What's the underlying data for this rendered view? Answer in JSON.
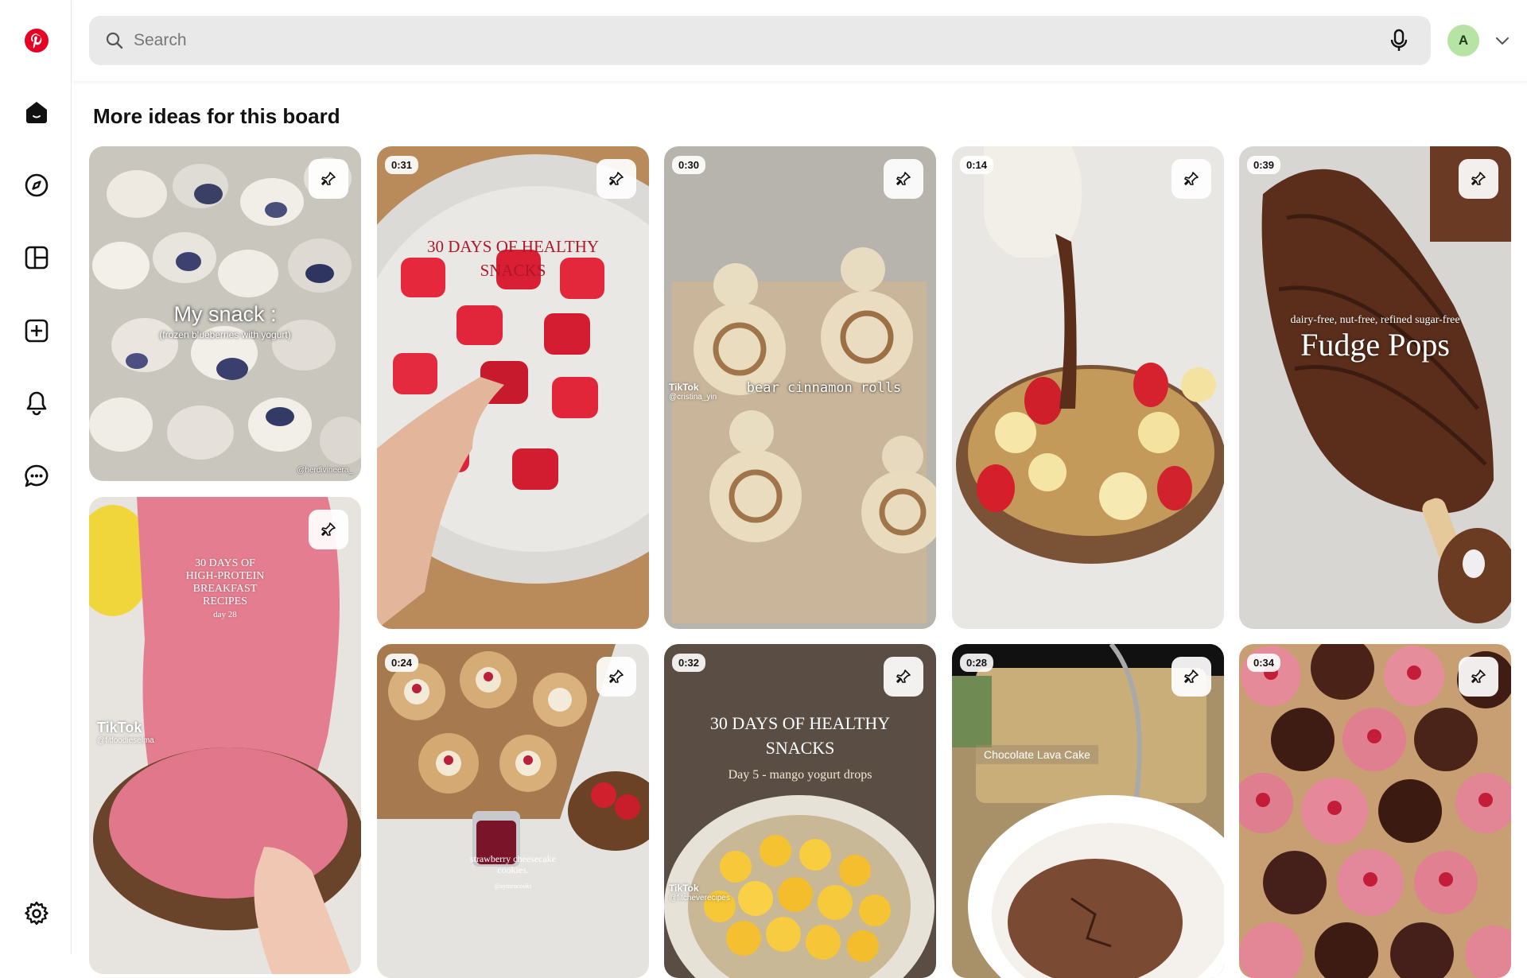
{
  "search": {
    "placeholder": "Search"
  },
  "user": {
    "avatar_letter": "A"
  },
  "section": {
    "title": "More ideas for this board"
  },
  "colors": {
    "brand": "#e60023",
    "search_bg": "#e9e9e9",
    "avatar_bg": "#b7e3a4"
  },
  "sidebar": {
    "items": [
      {
        "name": "logo",
        "icon": "pinterest-logo-icon"
      },
      {
        "name": "home",
        "icon": "home-icon"
      },
      {
        "name": "explore",
        "icon": "compass-icon"
      },
      {
        "name": "boards",
        "icon": "board-grid-icon"
      },
      {
        "name": "create",
        "icon": "plus-square-icon"
      },
      {
        "name": "notifications",
        "icon": "bell-icon"
      },
      {
        "name": "messages",
        "icon": "chat-icon"
      },
      {
        "name": "settings",
        "icon": "gear-icon"
      }
    ]
  },
  "pins": [
    {
      "title": "My snack :",
      "subtitle": "(frozen blueberries with yogurt)",
      "credit": "@herdivineera_"
    },
    {
      "duration": "0:31",
      "overlay": "30 DAYS OF HEALTHY SNACKS"
    },
    {
      "duration": "0:30",
      "overlay": "bear cinnamon rolls",
      "brand": "TikTok",
      "handle": "@cristina_yin"
    },
    {
      "duration": "0:14"
    },
    {
      "duration": "0:39",
      "subtitle": "dairy-free, nut-free, refined sugar-free",
      "title": "Fudge Pops"
    },
    {
      "overlay_lines": [
        "30 DAYS OF",
        "HIGH-PROTEIN",
        "BREAKFAST",
        "RECIPES",
        "day 28"
      ],
      "brand": "TikTok",
      "handle": "@fitfoodieselma"
    },
    {
      "duration": "0:24",
      "caption": "strawberry cheesecake cookies.",
      "credit": "@aymencooks"
    },
    {
      "duration": "0:32",
      "title_lines": [
        "30 DAYS OF HEALTHY",
        "SNACKS"
      ],
      "subtitle": "Day 5 - mango yogurt drops",
      "brand": "TikTok",
      "handle": "@fitcheverecipes"
    },
    {
      "duration": "0:28",
      "label": "Chocolate Lava Cake"
    },
    {
      "duration": "0:34"
    }
  ]
}
